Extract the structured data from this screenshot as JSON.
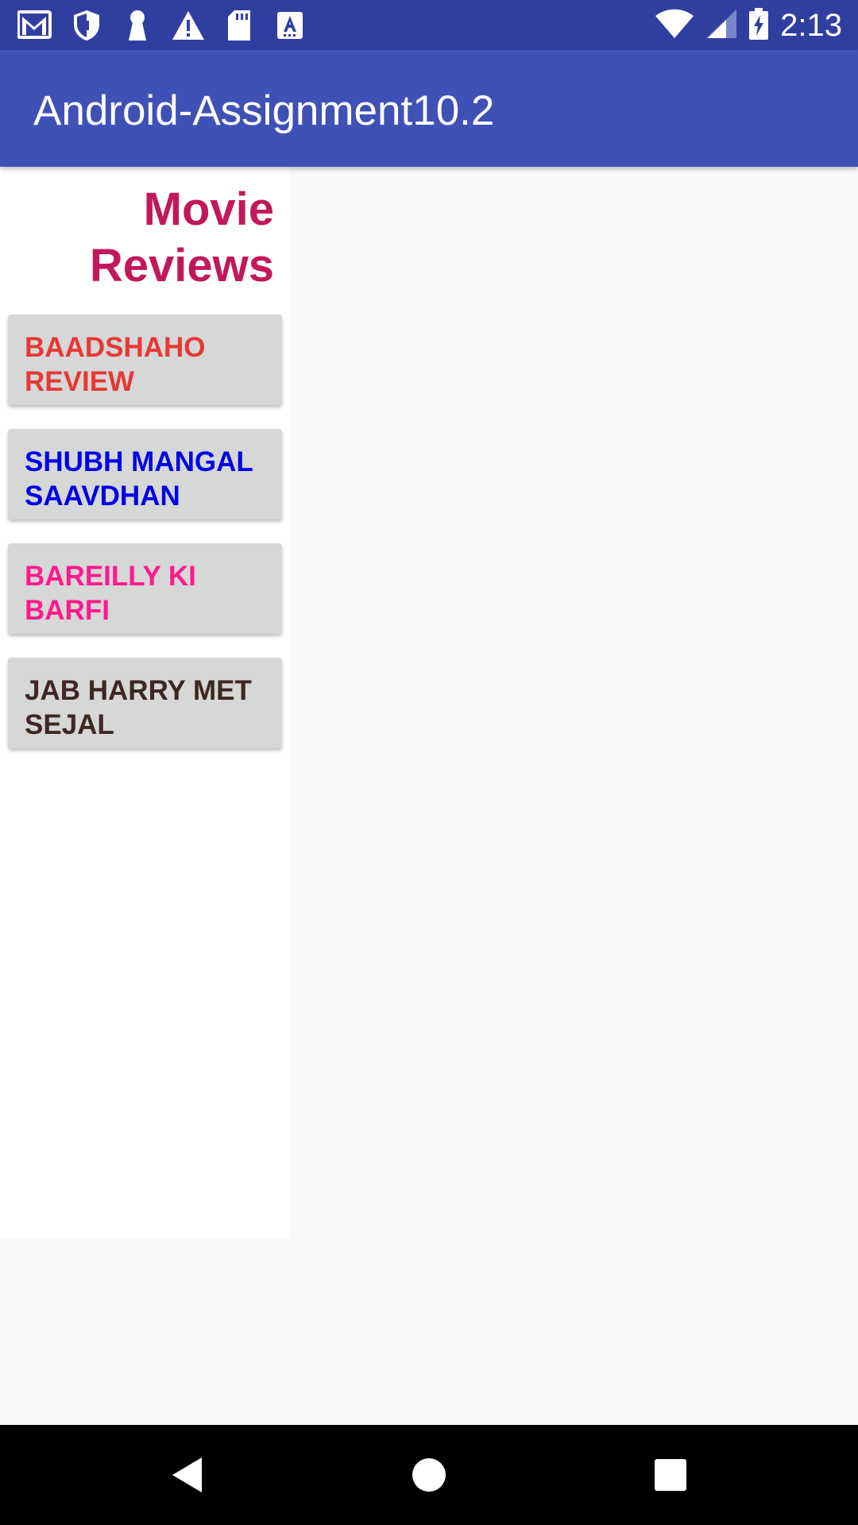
{
  "status_bar": {
    "time": "2:13",
    "left_icons": [
      "gmail-icon",
      "shield-icon",
      "keyhole-icon",
      "warning-icon",
      "sd-card-icon",
      "font-a-icon"
    ],
    "right_icons": [
      "wifi-icon",
      "signal-icon",
      "battery-charging-icon"
    ]
  },
  "app_bar": {
    "title": "Android-Assignment10.2"
  },
  "panel": {
    "heading": "Movie Reviews"
  },
  "movies": [
    {
      "label": "BAADSHAHO REVIEW",
      "color": "#e53935"
    },
    {
      "label": "SHUBH MANGAL SAAVDHAN",
      "color": "#0000e6"
    },
    {
      "label": "BAREILLY KI BARFI",
      "color": "#ff1a8c"
    },
    {
      "label": "JAB HARRY MET SEJAL",
      "color": "#3e2723"
    }
  ],
  "nav_bar": {
    "icons": [
      "back-icon",
      "home-icon",
      "recents-icon"
    ]
  },
  "colors": {
    "status_bar": "#303f9f",
    "app_bar": "#3f51b5",
    "heading": "#c2185b",
    "button_bg": "#d6d7d7"
  }
}
